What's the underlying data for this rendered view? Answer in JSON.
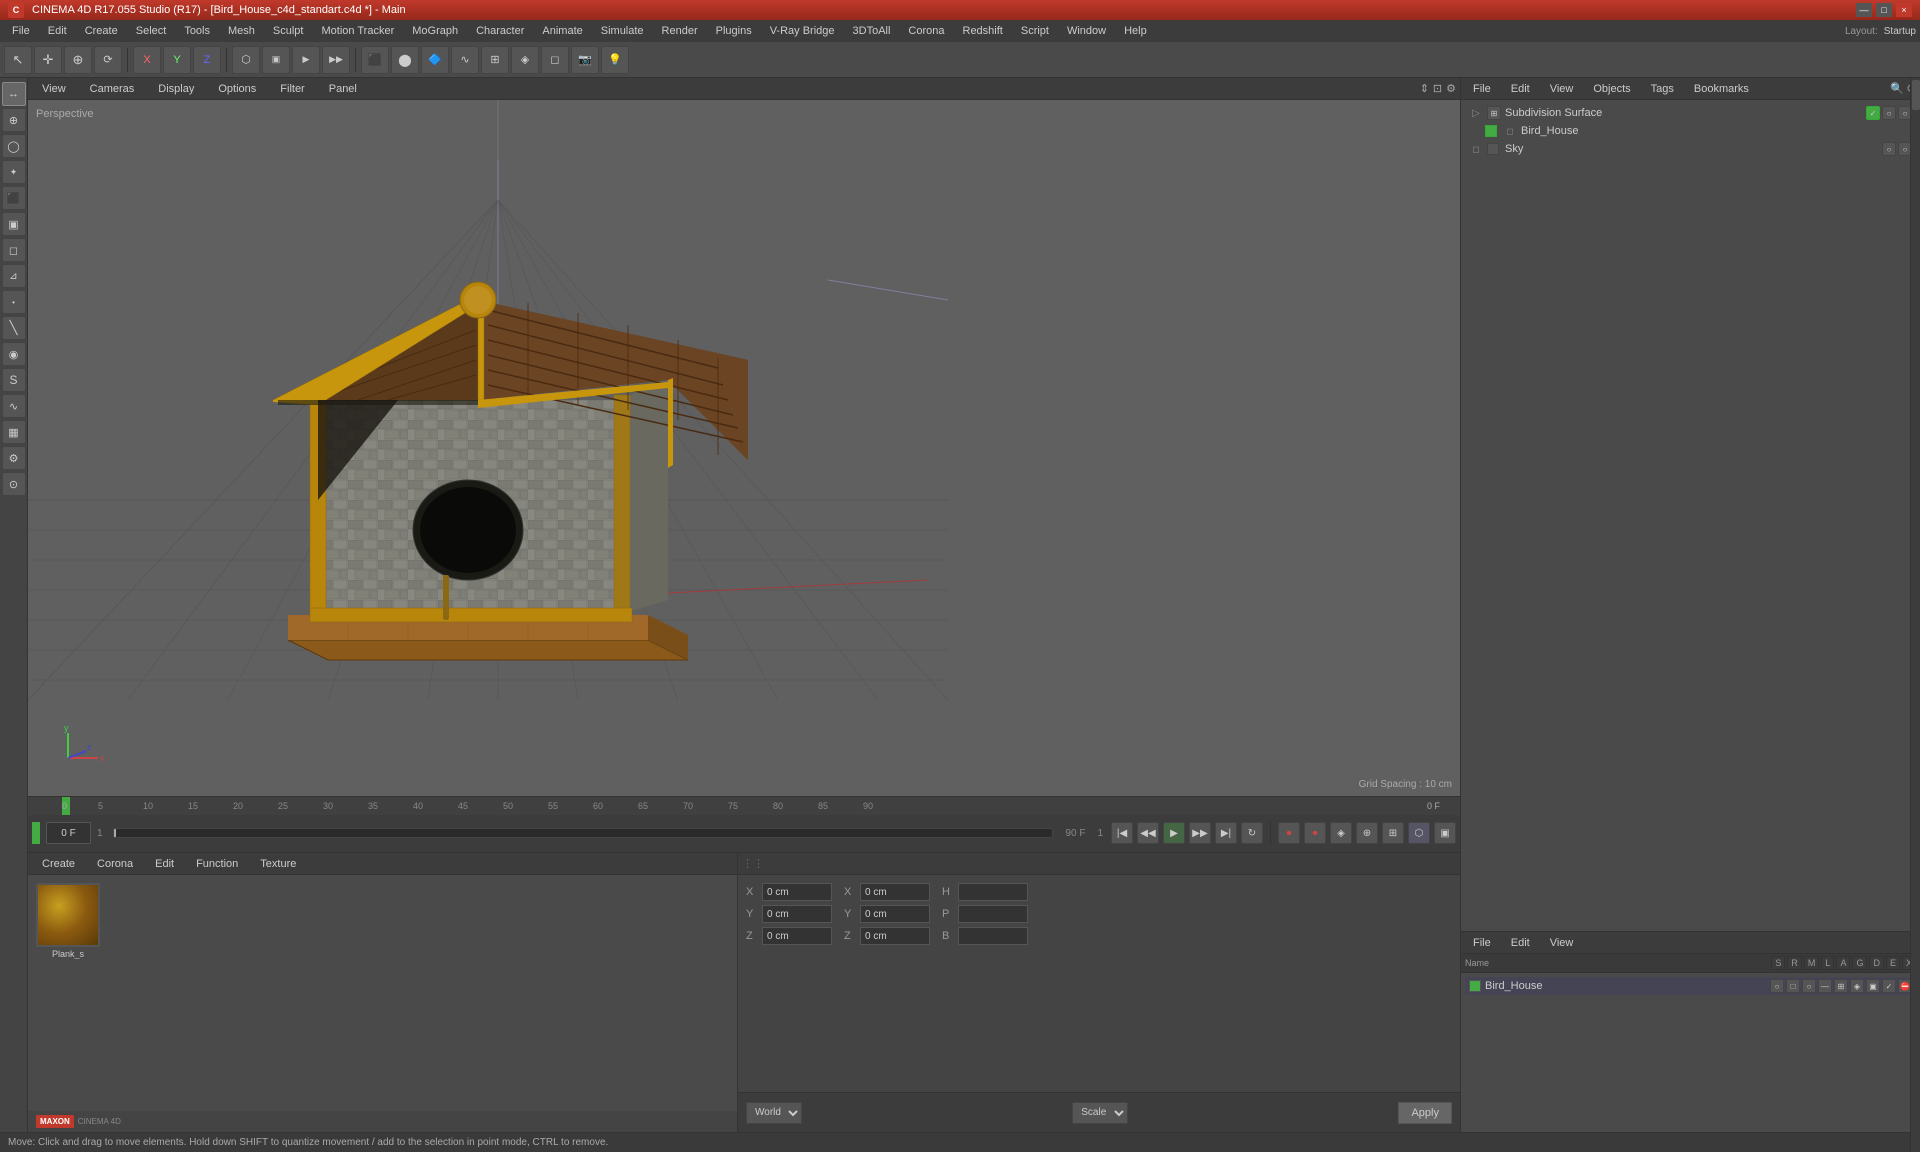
{
  "titlebar": {
    "title": "CINEMA 4D R17.055 Studio (R17) - [Bird_House_c4d_standart.c4d *] - Main",
    "close": "×",
    "minimize": "—",
    "maximize": "□"
  },
  "menubar": {
    "items": [
      "File",
      "Edit",
      "Create",
      "Select",
      "Tools",
      "Mesh",
      "Sculpt",
      "Motion Tracker",
      "MoGraph",
      "Character",
      "Animate",
      "Simulate",
      "Render",
      "Plugins",
      "V-Ray Bridge",
      "3DToAll",
      "Corona",
      "Redshift",
      "Script",
      "Window",
      "Help"
    ]
  },
  "layout": {
    "label": "Layout:",
    "value": "Startup"
  },
  "viewport": {
    "label": "Perspective",
    "grid_spacing": "Grid Spacing : 10 cm",
    "tabs": [
      "View",
      "Cameras",
      "Display",
      "Options",
      "Filter",
      "Panel"
    ]
  },
  "left_tools": [
    {
      "icon": "↔",
      "label": "move-tool"
    },
    {
      "icon": "⊕",
      "label": "scale-tool"
    },
    {
      "icon": "⊙",
      "label": "rotate-tool"
    },
    {
      "icon": "✦",
      "label": "select-tool"
    },
    {
      "icon": "⬛",
      "label": "cube-tool"
    },
    {
      "icon": "⊕",
      "label": "object-tool"
    },
    {
      "icon": "◻",
      "label": "polygon-tool"
    },
    {
      "icon": "⊿",
      "label": "edge-tool"
    },
    {
      "icon": "•",
      "label": "point-tool"
    },
    {
      "icon": "╲",
      "label": "line-tool"
    },
    {
      "icon": "◉",
      "label": "circle-tool"
    },
    {
      "icon": "S",
      "label": "spline-tool"
    },
    {
      "icon": "∿",
      "label": "curve-tool"
    },
    {
      "icon": "▦",
      "label": "grid-tool"
    },
    {
      "icon": "⚙",
      "label": "settings-tool"
    },
    {
      "icon": "⊙",
      "label": "extra-tool"
    }
  ],
  "toolbar": {
    "buttons": [
      "↔",
      "⊕",
      "⊙",
      "X",
      "Y",
      "Z",
      "⬡",
      "▶",
      "▶▶",
      "◀▶",
      "⊡",
      "◉",
      "✦",
      "⊕",
      "◈",
      "❋",
      "⊞",
      "◉◉",
      "◈"
    ]
  },
  "timeline": {
    "ticks": [
      0,
      5,
      10,
      15,
      20,
      25,
      30,
      35,
      40,
      45,
      50,
      55,
      60,
      65,
      70,
      75,
      80,
      85,
      90
    ],
    "current_frame": "0 F",
    "end_frame": "90 F",
    "frame_input": "0",
    "frame_step": "1"
  },
  "materials": {
    "tabs": [
      "Create",
      "Corona",
      "Edit",
      "Function",
      "Texture"
    ],
    "items": [
      {
        "label": "Plank_s",
        "color": "#8B6914"
      }
    ]
  },
  "coords": {
    "x_pos": "0 cm",
    "y_pos": "0 cm",
    "z_pos": "0 cm",
    "x_rot": "",
    "y_rot": "",
    "z_rot": "",
    "x_scale": "",
    "y_scale": "",
    "z_scale": "",
    "h_val": "",
    "p_val": "",
    "b_val": "",
    "world_label": "World",
    "scale_label": "Scale",
    "apply_label": "Apply"
  },
  "object_manager": {
    "tabs": [
      "File",
      "Edit",
      "View",
      "Objects",
      "Tags",
      "Bookmarks"
    ],
    "objects": [
      {
        "name": "Subdivision Surface",
        "indent": 0,
        "color": "#555",
        "icon": "⊞",
        "selected": false
      },
      {
        "name": "Bird_House",
        "indent": 1,
        "color": "#4a4",
        "icon": "◻",
        "selected": false
      },
      {
        "name": "Sky",
        "indent": 0,
        "color": "#555",
        "icon": "◻",
        "selected": false
      }
    ]
  },
  "attribute_manager": {
    "tabs": [
      "File",
      "Edit",
      "View"
    ],
    "columns": [
      "Name",
      "S",
      "R",
      "M",
      "L",
      "A",
      "G",
      "D",
      "E",
      "X"
    ],
    "items": [
      {
        "name": "Bird_House",
        "color": "#4a4",
        "selected": true
      }
    ]
  },
  "status_bar": {
    "text": "Move: Click and drag to move elements. Hold down SHIFT to quantize movement / add to the selection in point mode, CTRL to remove."
  },
  "colors": {
    "accent_red": "#c0392b",
    "bg_dark": "#3c3c3c",
    "bg_mid": "#4a4a4a",
    "bg_light": "#555555",
    "viewport_bg": "#606060",
    "grid_line": "rgba(100,100,100,0.5)",
    "green_indicator": "#44aa44",
    "blue_line": "#aaaacc"
  }
}
